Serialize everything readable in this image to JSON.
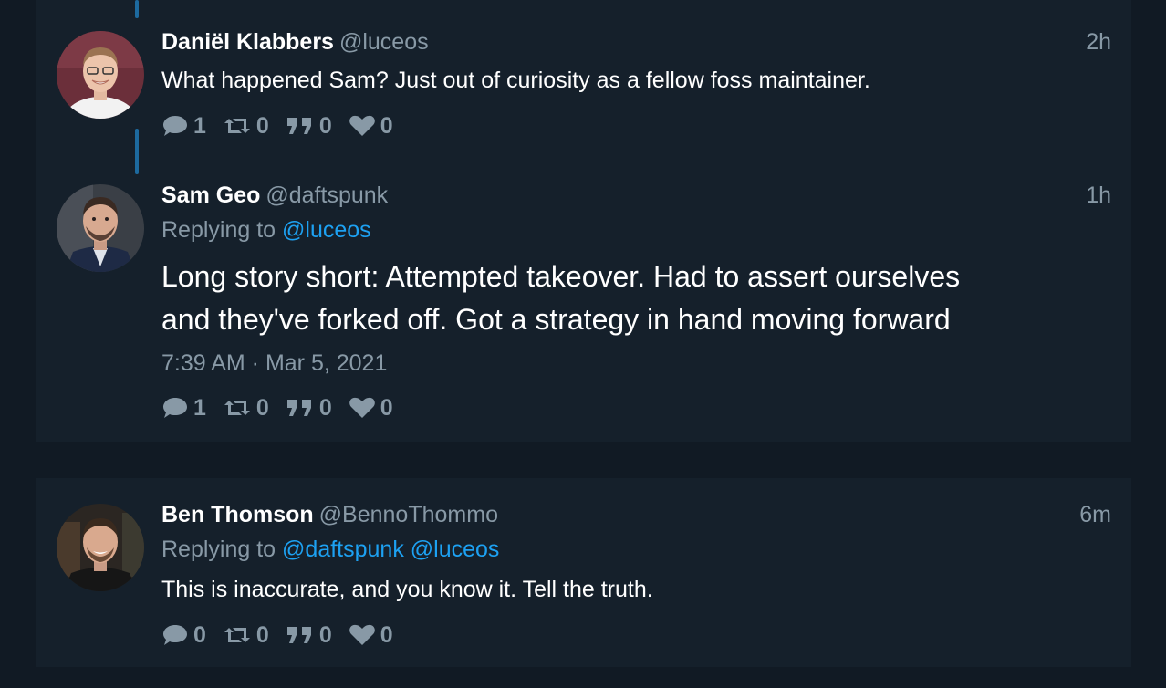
{
  "tweets": [
    {
      "name": "Daniël Klabbers",
      "handle": "@luceos",
      "time": "2h",
      "text": "What happened Sam? Just out of curiosity as a fellow foss maintainer.",
      "stats": {
        "replies": "1",
        "retweets": "0",
        "quotes": "0",
        "likes": "0"
      }
    },
    {
      "name": "Sam Geo",
      "handle": "@daftspunk",
      "time": "1h",
      "reply_prefix": "Replying to",
      "reply_mentions": [
        "@luceos"
      ],
      "text_lines": [
        "Long story short: Attempted takeover. Had to assert ourselves",
        "and they've forked off. Got a strategy in hand moving forward"
      ],
      "timestamp": "7:39 AM · Mar 5, 2021",
      "stats": {
        "replies": "1",
        "retweets": "0",
        "quotes": "0",
        "likes": "0"
      }
    },
    {
      "name": "Ben Thomson",
      "handle": "@BennoThommo",
      "time": "6m",
      "reply_prefix": "Replying to",
      "reply_mentions": [
        "@daftspunk",
        "@luceos"
      ],
      "text": "This is inaccurate, and you know it. Tell the truth.",
      "stats": {
        "replies": "0",
        "retweets": "0",
        "quotes": "0",
        "likes": "0"
      }
    }
  ],
  "icons": {
    "reply": "speech-bubble-icon",
    "retweet": "retweet-icon",
    "quote": "quote-icon",
    "like": "heart-icon"
  },
  "colors": {
    "background": "#111a24",
    "card": "#15202b",
    "muted": "#8899a6",
    "link": "#1da1f2",
    "thread_line": "#1d6a9f"
  }
}
